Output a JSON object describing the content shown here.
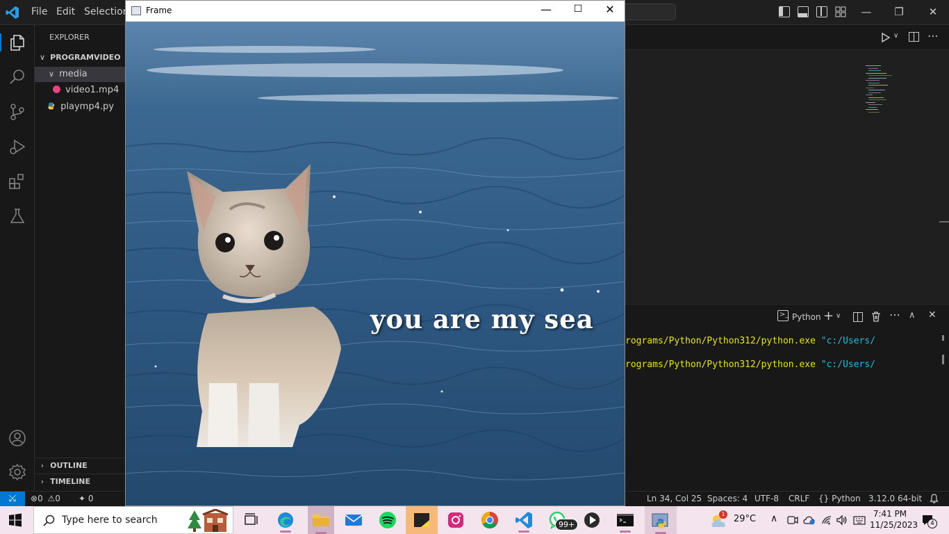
{
  "vscode": {
    "menu": [
      "File",
      "Edit",
      "Selection"
    ],
    "explorer": {
      "title": "EXPLORER",
      "folder": "PROGRAMVIDEO",
      "subfolder": "media",
      "files": [
        "video1.mp4",
        "playmp4.py"
      ],
      "outline": "OUTLINE",
      "timeline": "TIMELINE"
    },
    "panel": {
      "terminal_name": "Python",
      "lines": [
        {
          "path": "rograms/Python/Python312/python.exe",
          "arg": "\"c:/Users/"
        },
        {
          "path": "rograms/Python/Python312/python.exe",
          "arg": "\"c:/Users/"
        }
      ]
    },
    "status": {
      "errors": "0",
      "warnings": "0",
      "ports": "0",
      "position": "Ln 34, Col 25",
      "spaces": "Spaces: 4",
      "encoding": "UTF-8",
      "eol": "CRLF",
      "language": "Python",
      "interpreter": "3.12.0 64-bit"
    }
  },
  "frame": {
    "title": "Frame",
    "caption": "you are my sea"
  },
  "taskbar": {
    "search_placeholder": "Type here to search",
    "whatsapp_badge": "99+",
    "weather_badge": "1",
    "temperature": "29°C",
    "time": "7:41 PM",
    "date": "11/25/2023",
    "notification_count": "4"
  },
  "colors": {
    "accent": "#0078d4",
    "sea_dark": "#1d3b5e",
    "sea_mid": "#3f6a94",
    "terminal_yellow": "#e5e510",
    "terminal_cyan": "#29b8db"
  }
}
